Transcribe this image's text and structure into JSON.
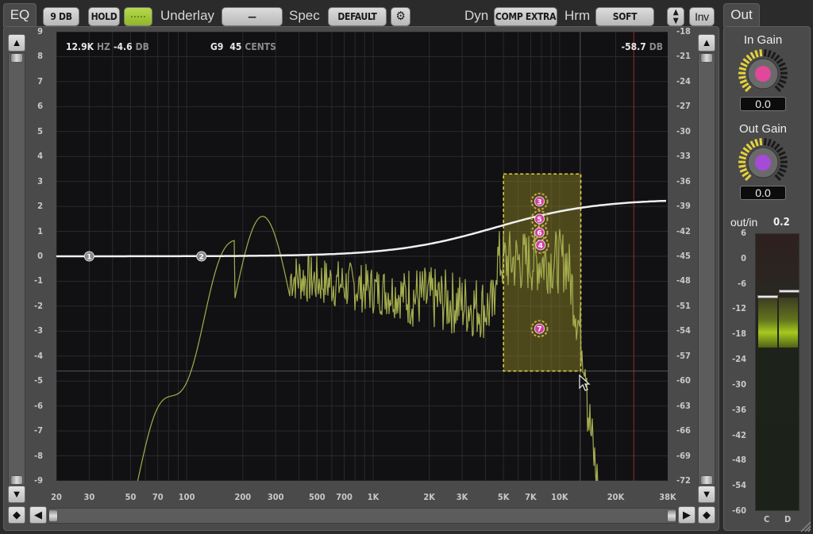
{
  "tabs": {
    "eq": "EQ",
    "out": "Out"
  },
  "toolbar": {
    "range_button": "9 DB",
    "hold_button": "HOLD",
    "color_swatch": "#a6cc3a",
    "underlay_label": "Underlay",
    "underlay_value": "—",
    "spec_label": "Spec",
    "spec_value": "DEFAULT",
    "settings_icon": "gear-icon",
    "dyn_label": "Dyn",
    "dyn_value": "COMP EXTRA",
    "hrm_label": "Hrm",
    "hrm_value": "SOFT",
    "updown_icon": "up-down-arrows-icon",
    "inv_button": "Inv"
  },
  "readouts": {
    "freq_value": "12.9K",
    "freq_unit": "HZ",
    "gain_value": "-4.6",
    "gain_unit": "DB",
    "note_value": "G9",
    "cents_value": "45",
    "cents_unit": "CENTS",
    "level_value": "-58.7",
    "level_unit": "DB"
  },
  "left_scale": [
    "9",
    "8",
    "7",
    "6",
    "5",
    "4",
    "3",
    "2",
    "1",
    "0",
    "-1",
    "-2",
    "-3",
    "-4",
    "-5",
    "-6",
    "-7",
    "-8",
    "-9"
  ],
  "right_scale": [
    "-18",
    "-21",
    "-24",
    "-27",
    "-30",
    "-33",
    "-36",
    "-39",
    "-42",
    "-45",
    "-48",
    "-51",
    "-54",
    "-57",
    "-60",
    "-63",
    "-66",
    "-69",
    "-72"
  ],
  "freq_labels": [
    {
      "hz": 20,
      "label": "20"
    },
    {
      "hz": 30,
      "label": "30"
    },
    {
      "hz": 50,
      "label": "50"
    },
    {
      "hz": 70,
      "label": "70"
    },
    {
      "hz": 100,
      "label": "100"
    },
    {
      "hz": 200,
      "label": "200"
    },
    {
      "hz": 300,
      "label": "300"
    },
    {
      "hz": 500,
      "label": "500"
    },
    {
      "hz": 700,
      "label": "700"
    },
    {
      "hz": 1000,
      "label": "1K"
    },
    {
      "hz": 2000,
      "label": "2K"
    },
    {
      "hz": 3000,
      "label": "3K"
    },
    {
      "hz": 5000,
      "label": "5K"
    },
    {
      "hz": 7000,
      "label": "7K"
    },
    {
      "hz": 10000,
      "label": "10K"
    },
    {
      "hz": 20000,
      "label": "20K"
    },
    {
      "hz": 38000,
      "label": "38K"
    }
  ],
  "eq_nodes": [
    {
      "id": "1",
      "hz": 30,
      "db": 0,
      "selected": false
    },
    {
      "id": "2",
      "hz": 120,
      "db": 0,
      "selected": false
    },
    {
      "id": "3",
      "hz": 7800,
      "db": 2.2,
      "selected": true
    },
    {
      "id": "5",
      "hz": 7800,
      "db": 1.5,
      "selected": true
    },
    {
      "id": "6",
      "hz": 7800,
      "db": 0.95,
      "selected": true
    },
    {
      "id": "4",
      "hz": 7900,
      "db": 0.45,
      "selected": true
    },
    {
      "id": "7",
      "hz": 7800,
      "db": -2.9,
      "selected": true
    }
  ],
  "selection_box": {
    "hz_min": 5000,
    "hz_max": 13000,
    "db_max": 3.3,
    "db_min": -4.6
  },
  "marker_hz": 25000,
  "out_panel": {
    "in_gain_label": "In Gain",
    "in_gain_value": "0.0",
    "out_gain_label": "Out Gain",
    "out_gain_value": "0.0",
    "ratio_label": "out/in",
    "ratio_value": "0.2",
    "meter_scale": [
      "6",
      "0",
      "-6",
      "-12",
      "-18",
      "-24",
      "-30",
      "-36",
      "-42",
      "-48",
      "-54",
      "-60"
    ],
    "meter_channels": [
      "C",
      "D"
    ],
    "meter_peaks_db": [
      -8.5,
      -7.2
    ],
    "meter_levels_db": [
      -21,
      -21
    ]
  }
}
